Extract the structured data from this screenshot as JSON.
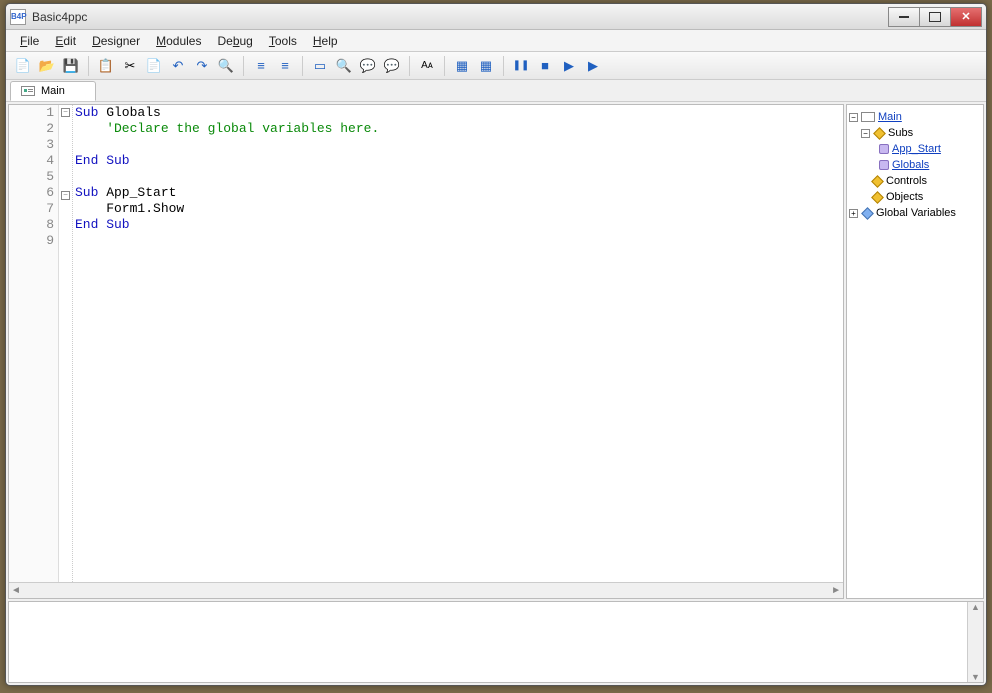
{
  "window": {
    "title": "Basic4ppc",
    "icon_label": "B4P"
  },
  "menu": {
    "file": {
      "label": "File",
      "key": "F"
    },
    "edit": {
      "label": "Edit",
      "key": "E"
    },
    "designer": {
      "label": "Designer",
      "key": "D"
    },
    "modules": {
      "label": "Modules",
      "key": "M"
    },
    "debug": {
      "label": "Debug",
      "key": "b"
    },
    "tools": {
      "label": "Tools",
      "key": "T"
    },
    "help": {
      "label": "Help",
      "key": "H"
    }
  },
  "toolbar": {
    "new": "📄",
    "open": "📂",
    "save": "💾",
    "copy": "📋",
    "cut": "✂",
    "paste": "📄",
    "undo": "↶",
    "redo": "↷",
    "find": "🔍",
    "outdent": "≡",
    "indent": "≡",
    "form": "▭",
    "design1": "🔍",
    "comment": "💬",
    "uncomment": "💬",
    "font": "Aᴀ",
    "bookmark_toggle": "▦",
    "bookmark_next": "▦",
    "pause": "❚❚",
    "stop": "■",
    "step": "▶",
    "run": "▶"
  },
  "tab": {
    "label": "Main"
  },
  "code": {
    "lines": [
      {
        "n": 1,
        "fold": "-",
        "seg": [
          {
            "t": "Sub",
            "c": "kw"
          },
          {
            "t": " Globals",
            "c": ""
          }
        ]
      },
      {
        "n": 2,
        "fold": "",
        "seg": [
          {
            "t": "    'Declare the global variables here.",
            "c": "cm"
          }
        ]
      },
      {
        "n": 3,
        "fold": "",
        "seg": [
          {
            "t": "",
            "c": ""
          }
        ]
      },
      {
        "n": 4,
        "fold": "",
        "seg": [
          {
            "t": "End Sub",
            "c": "kw"
          }
        ]
      },
      {
        "n": 5,
        "fold": "",
        "seg": [
          {
            "t": "",
            "c": ""
          }
        ]
      },
      {
        "n": 6,
        "fold": "-",
        "seg": [
          {
            "t": "Sub",
            "c": "kw"
          },
          {
            "t": " App_Start",
            "c": ""
          }
        ]
      },
      {
        "n": 7,
        "fold": "",
        "seg": [
          {
            "t": "    Form1.Show",
            "c": ""
          }
        ]
      },
      {
        "n": 8,
        "fold": "",
        "seg": [
          {
            "t": "End Sub",
            "c": "kw"
          }
        ]
      },
      {
        "n": 9,
        "fold": "",
        "seg": [
          {
            "t": "",
            "c": ""
          }
        ]
      }
    ]
  },
  "tree": {
    "main": "Main",
    "subs": "Subs",
    "app_start": "App_Start",
    "globals": "Globals",
    "controls": "Controls",
    "objects": "Objects",
    "global_vars": "Global Variables"
  }
}
